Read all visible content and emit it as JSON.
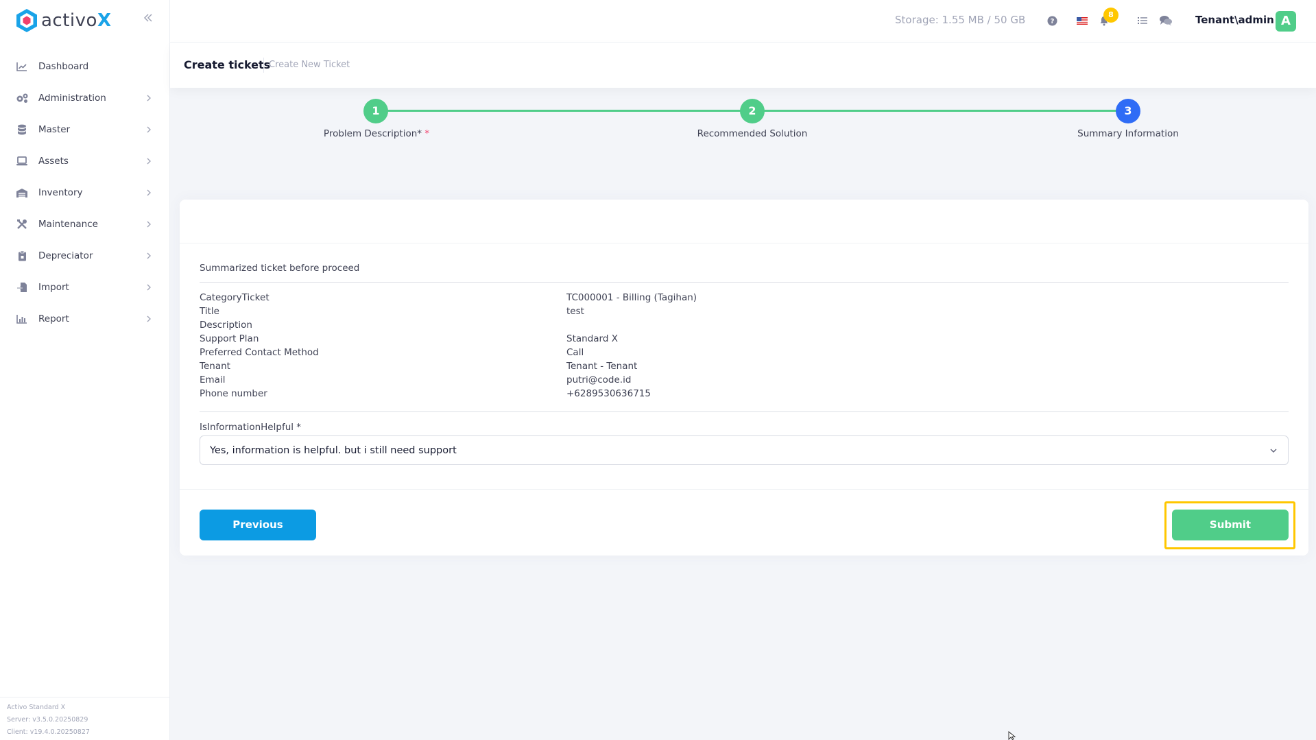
{
  "app": {
    "brand_name": "activo",
    "brand_x": "X",
    "accent_color": "#1aa3e8",
    "success_color": "#50cd89",
    "primary_color": "#0c9be3"
  },
  "sidebar": {
    "collapse_icon": "double-chevron-left-icon",
    "items": [
      {
        "label": "Dashboard",
        "icon": "chart-line-icon",
        "has_children": false
      },
      {
        "label": "Administration",
        "icon": "gears-icon",
        "has_children": true
      },
      {
        "label": "Master",
        "icon": "database-icon",
        "has_children": true
      },
      {
        "label": "Assets",
        "icon": "laptop-icon",
        "has_children": true
      },
      {
        "label": "Inventory",
        "icon": "warehouse-icon",
        "has_children": true
      },
      {
        "label": "Maintenance",
        "icon": "tools-icon",
        "has_children": true
      },
      {
        "label": "Depreciator",
        "icon": "clipboard-icon",
        "has_children": true
      },
      {
        "label": "Import",
        "icon": "file-import-icon",
        "has_children": true
      },
      {
        "label": "Report",
        "icon": "bar-chart-icon",
        "has_children": true
      }
    ],
    "footer": {
      "edition": "Activo Standard X",
      "server": "Server: v3.5.0.20250829",
      "client": "Client: v19.4.0.20250827"
    }
  },
  "header": {
    "storage": "Storage: 1.55 MB / 50 GB",
    "notification_count": "8",
    "user": "Tenant\\admin",
    "avatar_letter": "A"
  },
  "toolbar": {
    "title": "Create tickets",
    "subtitle": "Create New Ticket"
  },
  "stepper": {
    "steps": [
      {
        "number": "1",
        "label": "Problem Description*",
        "required_mark": "*",
        "state": "done"
      },
      {
        "number": "2",
        "label": "Recommended Solution",
        "state": "done"
      },
      {
        "number": "3",
        "label": "Summary Information",
        "state": "active"
      }
    ]
  },
  "summary": {
    "heading": "Summarized ticket before proceed",
    "rows": [
      {
        "key": "CategoryTicket",
        "value": "TC000001 - Billing (Tagihan)"
      },
      {
        "key": "Title",
        "value": "test"
      },
      {
        "key": "Description",
        "value": ""
      },
      {
        "key": "Support Plan",
        "value": "Standard X"
      },
      {
        "key": "Preferred Contact Method",
        "value": "Call"
      },
      {
        "key": "Tenant",
        "value": "Tenant - Tenant"
      },
      {
        "key": "Email",
        "value": "putri@code.id"
      },
      {
        "key": "Phone number",
        "value": "+6289530636715"
      }
    ],
    "helpful_label": "IsInformationHelpful *",
    "helpful_value": "Yes, information is helpful. but i still need support"
  },
  "actions": {
    "previous": "Previous",
    "submit": "Submit"
  }
}
